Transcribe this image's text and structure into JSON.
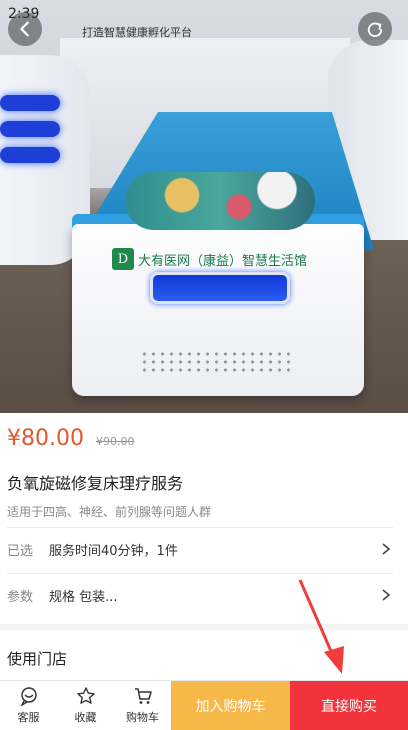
{
  "status_bar": {
    "time": "2:39"
  },
  "hero": {
    "banner_text": "打造智慧健康孵化平台",
    "bed_logo_text": "大有医网（康益）智慧生活馆"
  },
  "product": {
    "price": "¥80.00",
    "original_price": "¥90.00",
    "title": "负氧旋磁修复床理疗服务",
    "subtitle": "适用于四高、神经、前列腺等问题人群"
  },
  "options": {
    "selected_label": "已选",
    "selected_value": "服务时间40分钟，1件",
    "params_label": "参数",
    "params_value": "规格 包装..."
  },
  "stores_heading": "使用门店",
  "tabbar": {
    "service_label": "客服",
    "favorite_label": "收藏",
    "cart_label": "购物车",
    "add_to_cart_label": "加入购物车",
    "buy_now_label": "直接购买"
  },
  "colors": {
    "price": "#e4572e",
    "add_to_cart": "#f7b84a",
    "buy_now": "#f2333c",
    "annotation_arrow": "#f23b3b"
  }
}
